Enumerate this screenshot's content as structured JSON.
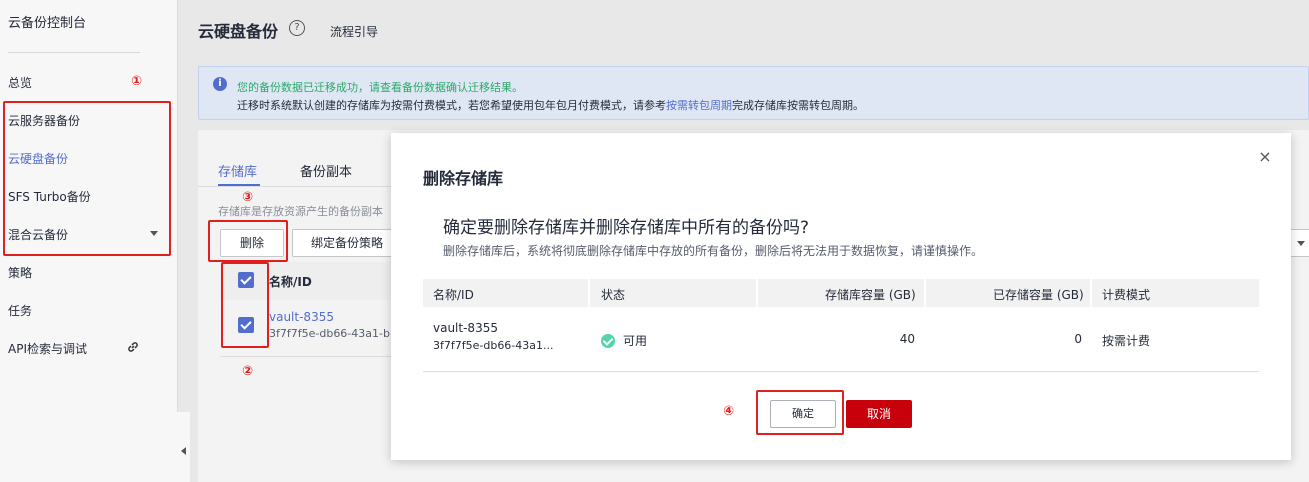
{
  "sidebar": {
    "title": "云备份控制台",
    "items": [
      {
        "label": "总览"
      },
      {
        "label": "云服务器备份"
      },
      {
        "label": "云硬盘备份"
      },
      {
        "label": "SFS Turbo备份"
      },
      {
        "label": "混合云备份"
      },
      {
        "label": "策略"
      },
      {
        "label": "任务"
      },
      {
        "label": "API检索与调试"
      }
    ]
  },
  "header": {
    "title": "云硬盘备份",
    "help_glyph": "?",
    "guide_link": "流程引导"
  },
  "notice": {
    "info_glyph": "i",
    "line1": "您的备份数据已迁移成功，请查看备份数据确认迁移结果。",
    "line2_prefix": "迁移时系统默认创建的存储库为按需付费模式，若您希望使用包年包月付费模式，请参考",
    "line2_link": "按需转包周期",
    "line2_suffix": "完成存储库按需转包周期。"
  },
  "main": {
    "tabs": [
      {
        "label": "存储库"
      },
      {
        "label": "备份副本"
      }
    ],
    "description": "存储库是存放资源产生的备份副本",
    "toolbar": {
      "delete_label": "删除",
      "bind_policy_label": "绑定备份策略"
    },
    "table": {
      "header_name": "名称/ID",
      "rows": [
        {
          "name": "vault-8355",
          "id": "3f7f7f5e-db66-43a1-b"
        }
      ]
    }
  },
  "annotations": {
    "marker1": "①",
    "marker2": "②",
    "marker3": "③",
    "marker4": "④",
    "color": "#e0201f"
  },
  "dialog": {
    "title": "删除存储库",
    "close_glyph": "×",
    "question": "确定要删除存储库并删除存储库中所有的备份吗?",
    "warning": "删除存储库后，系统将彻底删除存储库中存放的所有备份，删除后将无法用于数据恢复，请谨慎操作。",
    "columns": [
      "名称/ID",
      "状态",
      "存储库容量 (GB)",
      "已存储容量 (GB)",
      "计费模式"
    ],
    "row": {
      "name": "vault-8355",
      "id": "3f7f7f5e-db66-43a1...",
      "status": "可用",
      "capacity": "40",
      "used": "0",
      "billing": "按需计费"
    },
    "confirm_label": "确定",
    "cancel_label": "取消"
  },
  "colors": {
    "accent": "#526ecc",
    "danger": "#c7000b",
    "status_ok": "#50d4ab"
  }
}
